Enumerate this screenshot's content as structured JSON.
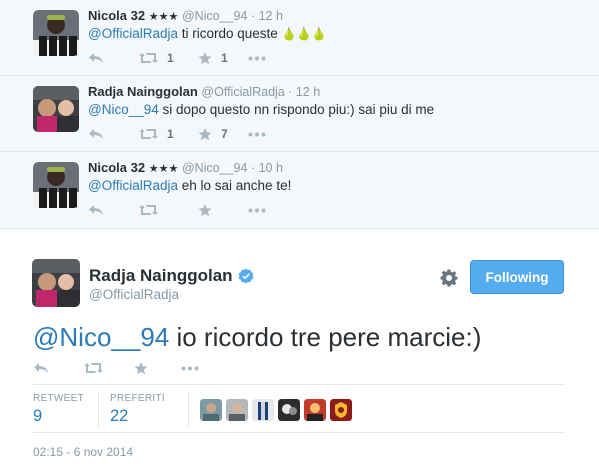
{
  "replies": [
    {
      "name": "Nicola 32",
      "stars": "★★★",
      "handle": "@Nico__94",
      "time": "12 h",
      "mention": "@OfficialRadja",
      "text": " ti ricordo queste ",
      "emoji": "🍐🍐🍐",
      "retweets": "1",
      "favorites": "1"
    },
    {
      "name": "Radja Nainggolan",
      "stars": "",
      "handle": "@OfficialRadja",
      "time": "12 h",
      "mention": "@Nico__94",
      "text": " si dopo questo nn rispondo piu:) sai piu di me",
      "emoji": "",
      "retweets": "1",
      "favorites": "7"
    },
    {
      "name": "Nicola 32",
      "stars": "★★★",
      "handle": "@Nico__94",
      "time": "10 h",
      "mention": "@OfficialRadja",
      "text": " eh lo sai anche te!",
      "emoji": "",
      "retweets": "",
      "favorites": ""
    }
  ],
  "main_tweet": {
    "name": "Radja Nainggolan",
    "handle": "@OfficialRadja",
    "follow_label": "Following",
    "mention": "@Nico__94",
    "text": " io ricordo tre pere marcie:)",
    "stats": {
      "retweet_label": "RETWEET",
      "retweet_count": "9",
      "favorites_label": "PREFERITI",
      "favorites_count": "22"
    },
    "timestamp": "02:15 - 6 nov 2014"
  },
  "separator": " · ",
  "colors": {
    "link": "#2b7bb9",
    "follow_button": "#55acee",
    "muted": "#8899a6",
    "background_conversation": "#f5f8fa"
  },
  "icons": [
    "reply-icon",
    "retweet-icon",
    "favorite-star-icon",
    "more-dots-icon",
    "gear-icon",
    "verified-badge-icon"
  ]
}
